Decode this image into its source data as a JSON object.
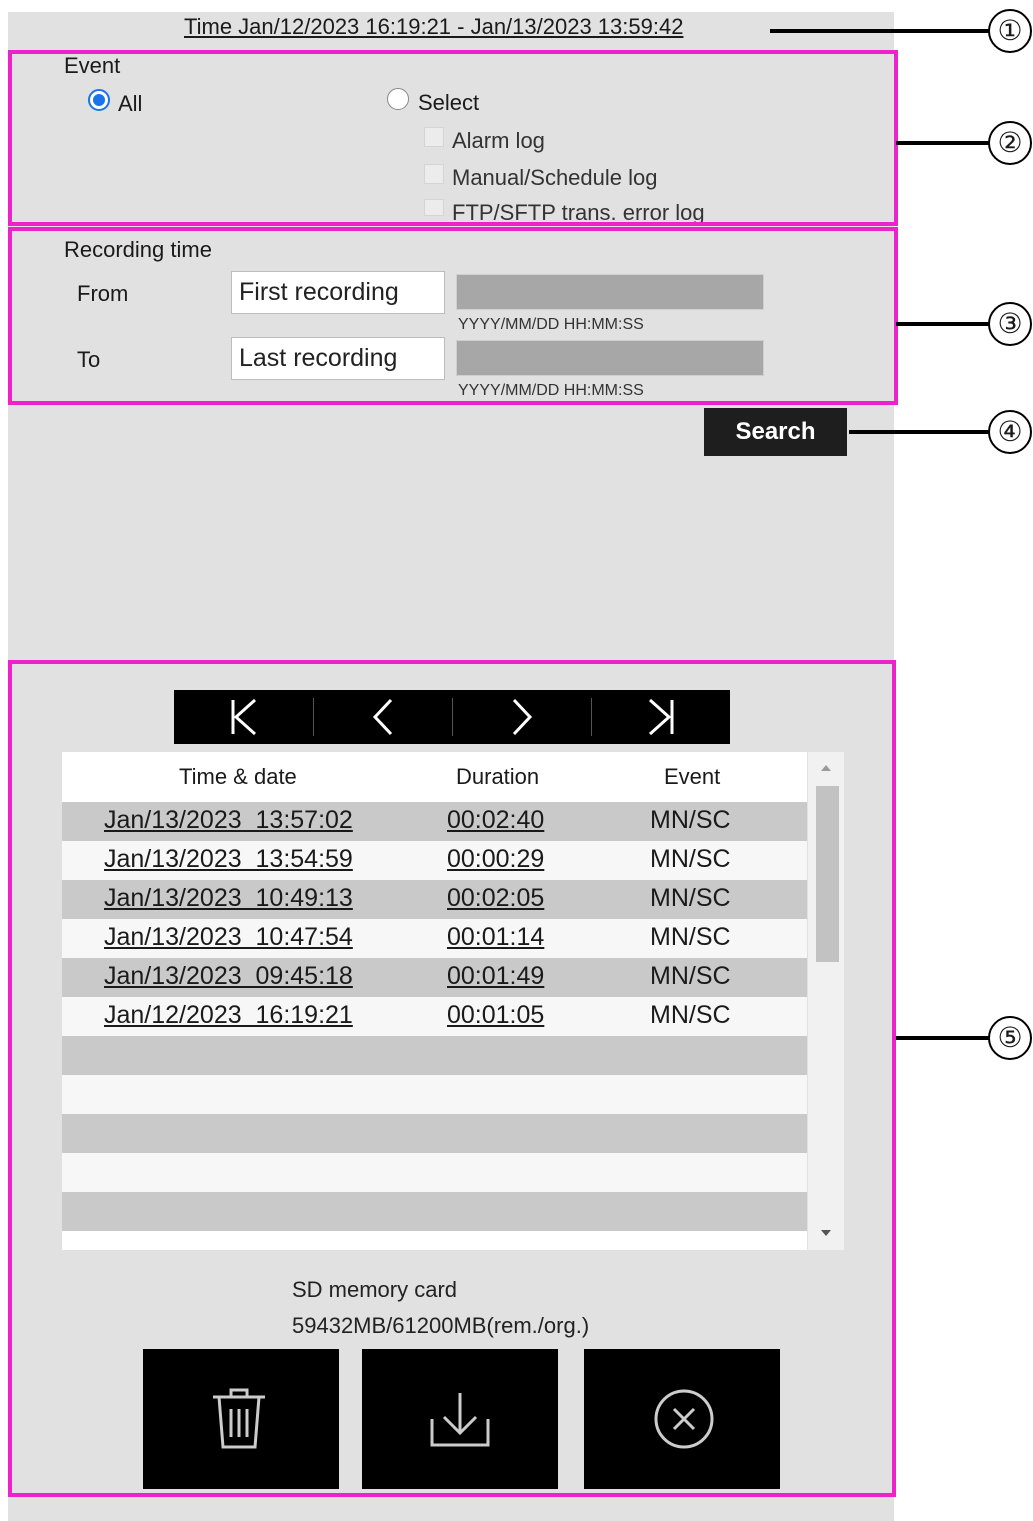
{
  "header": {
    "time_range": "Time Jan/12/2023 16:19:21 - Jan/13/2023 13:59:42"
  },
  "event": {
    "title": "Event",
    "all_label": "All",
    "select_label": "Select",
    "selected": "All",
    "options": [
      "Alarm log",
      "Manual/Schedule log",
      "FTP/SFTP trans. error log"
    ]
  },
  "recording": {
    "title": "Recording time",
    "from_label": "From",
    "to_label": "To",
    "from_value": "First recording",
    "to_value": "Last recording",
    "format_hint": "YYYY/MM/DD HH:MM:SS"
  },
  "search": {
    "label": "Search"
  },
  "pager": {
    "first": "K",
    "prev": "‹",
    "next": "›",
    "last": "K"
  },
  "table": {
    "columns": [
      "Time & date",
      "Duration",
      "Event"
    ],
    "rows": [
      {
        "time": "Jan/13/2023  13:57:02",
        "duration": "00:02:40",
        "event": "MN/SC"
      },
      {
        "time": "Jan/13/2023  13:54:59",
        "duration": "00:00:29",
        "event": "MN/SC"
      },
      {
        "time": "Jan/13/2023  10:49:13",
        "duration": "00:02:05",
        "event": "MN/SC"
      },
      {
        "time": "Jan/13/2023  10:47:54",
        "duration": "00:01:14",
        "event": "MN/SC"
      },
      {
        "time": "Jan/13/2023  09:45:18",
        "duration": "00:01:49",
        "event": "MN/SC"
      },
      {
        "time": "Jan/12/2023  16:19:21",
        "duration": "00:01:05",
        "event": "MN/SC"
      }
    ]
  },
  "storage": {
    "label": "SD memory card",
    "usage": "59432MB/61200MB(rem./org.)"
  },
  "actions": [
    {
      "icon": "trash-icon"
    },
    {
      "icon": "download-icon"
    },
    {
      "icon": "close-circle-icon"
    }
  ],
  "callouts": [
    "①",
    "②",
    "③",
    "④",
    "⑤"
  ],
  "colors": {
    "highlight": "#ee22cc",
    "panel": "#e1e1e1",
    "button": "#1e1e1e",
    "radio": "#1a73e8"
  }
}
